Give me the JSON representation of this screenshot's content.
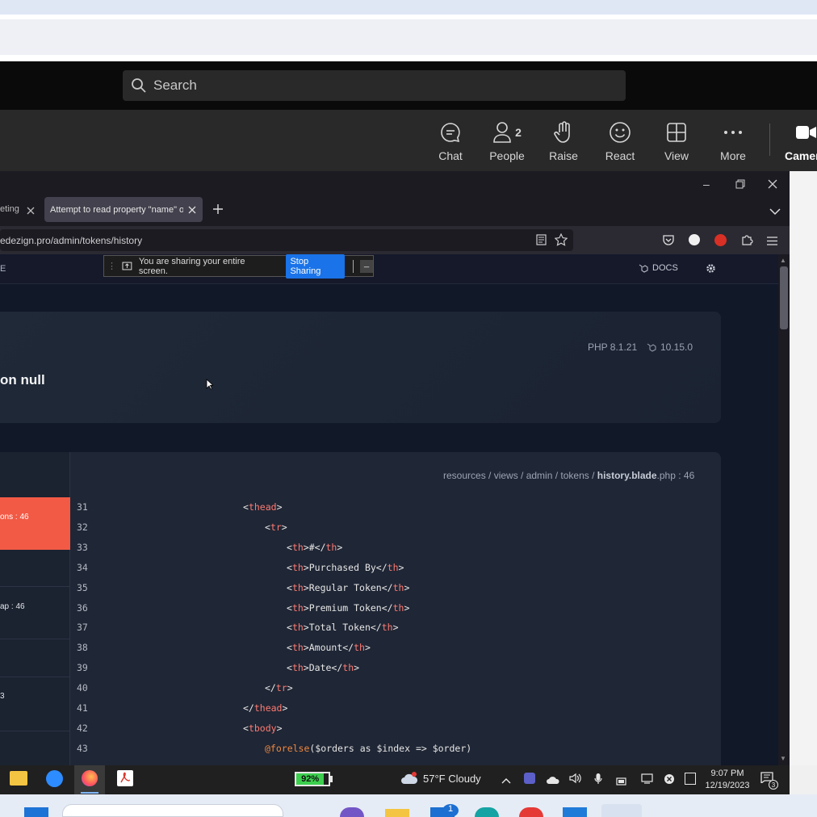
{
  "teams": {
    "search_placeholder": "Search",
    "toolbar": [
      {
        "label": "Chat",
        "icon": "chat-icon"
      },
      {
        "label": "People",
        "icon": "people-icon",
        "badge": "2"
      },
      {
        "label": "Raise",
        "icon": "hand-icon"
      },
      {
        "label": "React",
        "icon": "smile-icon"
      },
      {
        "label": "View",
        "icon": "grid-icon"
      },
      {
        "label": "More",
        "icon": "more-icon"
      },
      {
        "label": "Camer",
        "icon": "camera-icon"
      }
    ]
  },
  "browser": {
    "tab_inactive_label": "eting",
    "tab_active_label": "Attempt to read property \"name\" o",
    "url": "edezign.pro/admin/tokens/history"
  },
  "share_bar": {
    "message": "You are sharing your entire screen.",
    "stop_label": "Stop Sharing",
    "minimize_label": "_"
  },
  "appnav": {
    "left_label": "E",
    "docs_label": "DOCS"
  },
  "error_card": {
    "php_version": "PHP 8.1.21",
    "laravel_version": "10.15.0",
    "message_fragment": "on null"
  },
  "stack": {
    "frame_active": "ons : 46",
    "frame_2": "ap : 46",
    "frame_3": "3"
  },
  "code": {
    "file_path_prefix": "resources / views / admin / tokens / ",
    "file_name": "history.blade",
    "file_ext_line": ".php : 46",
    "lines": [
      {
        "num": "31",
        "indent": 0,
        "parts": [
          [
            "t",
            "<"
          ],
          [
            "tag",
            "thead"
          ],
          [
            "t",
            ">"
          ]
        ]
      },
      {
        "num": "32",
        "indent": 1,
        "parts": [
          [
            "t",
            "<"
          ],
          [
            "tag",
            "tr"
          ],
          [
            "t",
            ">"
          ]
        ]
      },
      {
        "num": "33",
        "indent": 2,
        "parts": [
          [
            "t",
            "<"
          ],
          [
            "tag",
            "th"
          ],
          [
            "t",
            ">#</"
          ],
          [
            "tag",
            "th"
          ],
          [
            "t",
            ">"
          ]
        ]
      },
      {
        "num": "34",
        "indent": 2,
        "parts": [
          [
            "t",
            "<"
          ],
          [
            "tag",
            "th"
          ],
          [
            "t",
            ">Purchased By</"
          ],
          [
            "tag",
            "th"
          ],
          [
            "t",
            ">"
          ]
        ]
      },
      {
        "num": "35",
        "indent": 2,
        "parts": [
          [
            "t",
            "<"
          ],
          [
            "tag",
            "th"
          ],
          [
            "t",
            ">Regular Token</"
          ],
          [
            "tag",
            "th"
          ],
          [
            "t",
            ">"
          ]
        ]
      },
      {
        "num": "36",
        "indent": 2,
        "parts": [
          [
            "t",
            "<"
          ],
          [
            "tag",
            "th"
          ],
          [
            "t",
            ">Premium Token</"
          ],
          [
            "tag",
            "th"
          ],
          [
            "t",
            ">"
          ]
        ]
      },
      {
        "num": "37",
        "indent": 2,
        "parts": [
          [
            "t",
            "<"
          ],
          [
            "tag",
            "th"
          ],
          [
            "t",
            ">Total Token</"
          ],
          [
            "tag",
            "th"
          ],
          [
            "t",
            ">"
          ]
        ]
      },
      {
        "num": "38",
        "indent": 2,
        "parts": [
          [
            "t",
            "<"
          ],
          [
            "tag",
            "th"
          ],
          [
            "t",
            ">Amount</"
          ],
          [
            "tag",
            "th"
          ],
          [
            "t",
            ">"
          ]
        ]
      },
      {
        "num": "39",
        "indent": 2,
        "parts": [
          [
            "t",
            "<"
          ],
          [
            "tag",
            "th"
          ],
          [
            "t",
            ">Date</"
          ],
          [
            "tag",
            "th"
          ],
          [
            "t",
            ">"
          ]
        ]
      },
      {
        "num": "40",
        "indent": 1,
        "parts": [
          [
            "t",
            "</"
          ],
          [
            "tag",
            "tr"
          ],
          [
            "t",
            ">"
          ]
        ]
      },
      {
        "num": "41",
        "indent": 0,
        "parts": [
          [
            "t",
            "</"
          ],
          [
            "tag",
            "thead"
          ],
          [
            "t",
            ">"
          ]
        ]
      },
      {
        "num": "42",
        "indent": 0,
        "parts": [
          [
            "t",
            "<"
          ],
          [
            "tag",
            "tbody"
          ],
          [
            "t",
            ">"
          ]
        ]
      },
      {
        "num": "43",
        "indent": 1,
        "parts": [
          [
            "kw",
            "@forelse"
          ],
          [
            "t",
            "($orders as $index => $order)"
          ]
        ]
      }
    ]
  },
  "taskbar": {
    "battery_percent": "92%",
    "battery_level": 0.92,
    "weather": "57°F  Cloudy",
    "weather_badge": "1",
    "time": "9:07 PM",
    "date": "12/19/2023",
    "notification_count": "3"
  },
  "colors": {
    "accent_red": "#f25a45",
    "stop_sharing_blue": "#1a73e8",
    "code_tag": "#ff7b72",
    "code_keyword": "#f0883e"
  }
}
